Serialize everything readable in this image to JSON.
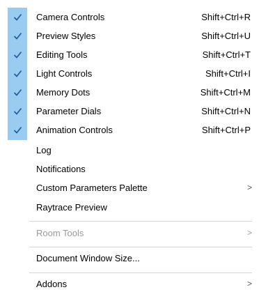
{
  "colors": {
    "check_gutter": "#99ccf0",
    "check_mark": "#1e5a96",
    "disabled_text": "#9a9a9a",
    "separator": "#d6d6d6"
  },
  "menu": {
    "items": [
      {
        "label": "Camera Controls",
        "shortcut": "Shift+Ctrl+R",
        "checked": true,
        "icon": "checkmark-icon"
      },
      {
        "label": "Preview Styles",
        "shortcut": "Shift+Ctrl+U",
        "checked": true,
        "icon": "checkmark-icon"
      },
      {
        "label": "Editing Tools",
        "shortcut": "Shift+Ctrl+T",
        "checked": true,
        "icon": "checkmark-icon"
      },
      {
        "label": "Light Controls",
        "shortcut": "Shift+Ctrl+I",
        "checked": true,
        "icon": "checkmark-icon"
      },
      {
        "label": "Memory Dots",
        "shortcut": "Shift+Ctrl+M",
        "checked": true,
        "icon": "checkmark-icon"
      },
      {
        "label": "Parameter Dials",
        "shortcut": "Shift+Ctrl+N",
        "checked": true,
        "icon": "checkmark-icon"
      },
      {
        "label": "Animation Controls",
        "shortcut": "Shift+Ctrl+P",
        "checked": true,
        "icon": "checkmark-icon"
      },
      {
        "label": "Log"
      },
      {
        "label": "Notifications"
      },
      {
        "label": "Custom Parameters Palette",
        "submenu_glyph": ">",
        "icon": "chevron-right-icon"
      },
      {
        "label": "Raytrace Preview"
      },
      {
        "label": "Room Tools",
        "submenu_glyph": ">",
        "icon": "chevron-right-icon",
        "disabled": true
      },
      {
        "label": "Document Window Size..."
      },
      {
        "label": "Addons",
        "submenu_glyph": ">",
        "icon": "chevron-right-icon"
      }
    ]
  }
}
